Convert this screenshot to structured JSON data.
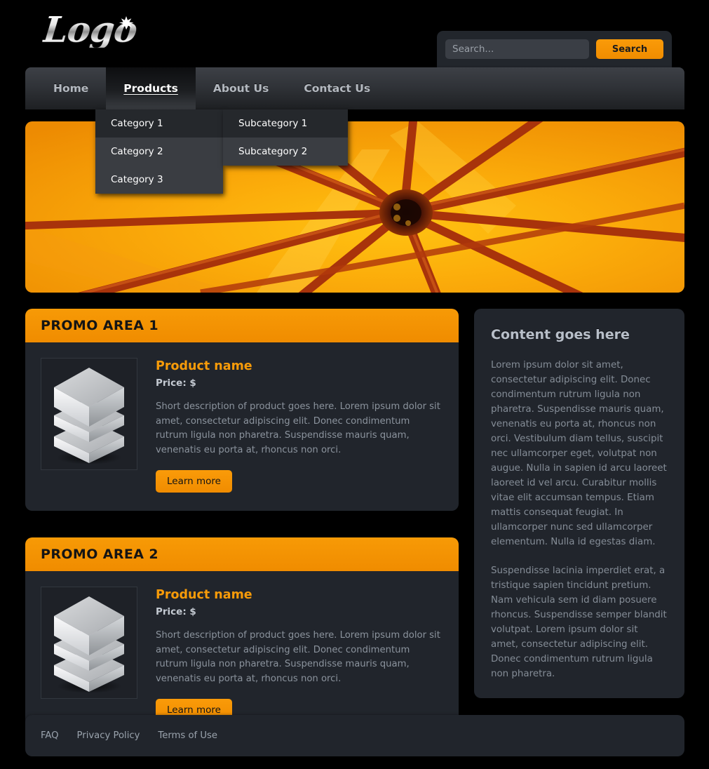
{
  "brand": {
    "logo_text": "Logo",
    "star_icon": "star-sparkle-icon"
  },
  "search": {
    "placeholder": "Search...",
    "value": "",
    "button_label": "Search"
  },
  "nav": {
    "items": [
      {
        "label": "Home",
        "active": false
      },
      {
        "label": "Products",
        "active": true
      },
      {
        "label": "About Us",
        "active": false
      },
      {
        "label": "Contact Us",
        "active": false
      }
    ]
  },
  "dropdown": {
    "categories": [
      {
        "label": "Category 1",
        "hovered": true
      },
      {
        "label": "Category 2",
        "hovered": false
      },
      {
        "label": "Category 3",
        "hovered": false
      }
    ],
    "subcategories": [
      {
        "label": "Subcategory 1"
      },
      {
        "label": "Subcategory 2"
      }
    ]
  },
  "hero": {
    "alt": "orange umbrella canopy seen from below"
  },
  "promos": [
    {
      "heading": "PROMO AREA 1",
      "product_name": "Product name",
      "price": "Price: $",
      "description": "Short description of product goes here. Lorem ipsum dolor sit amet, consectetur adipiscing elit. Donec condimentum rutrum ligula non pharetra. Suspendisse mauris quam, venenatis eu porta at, rhoncus non orci.",
      "button_label": "Learn more",
      "thumb_icon": "stacked-cubes-icon"
    },
    {
      "heading": "PROMO AREA 2",
      "product_name": "Product name",
      "price": "Price: $",
      "description": "Short description of product goes here. Lorem ipsum dolor sit amet, consectetur adipiscing elit. Donec condimentum rutrum ligula non pharetra. Suspendisse mauris quam, venenatis eu porta at, rhoncus non orci.",
      "button_label": "Learn more",
      "thumb_icon": "stacked-cubes-icon"
    }
  ],
  "sidebar": {
    "title": "Content goes here",
    "paragraphs": [
      "Lorem ipsum dolor sit amet, consectetur adipiscing elit. Donec condimentum rutrum ligula non pharetra. Suspendisse mauris quam, venenatis eu porta at, rhoncus non orci. Vestibulum diam tellus, suscipit nec ullamcorper eget, volutpat non augue. Nulla in sapien id arcu laoreet laoreet id vel arcu. Curabitur mollis vitae elit accumsan tempus. Etiam mattis consequat feugiat. In ullamcorper nunc sed ullamcorper elementum. Nulla id egestas diam.",
      "Suspendisse lacinia imperdiet erat, a tristique sapien tincidunt pretium. Nam vehicula sem id diam posuere rhoncus. Suspendisse semper blandit volutpat. Lorem ipsum dolor sit amet, consectetur adipiscing elit. Donec condimentum rutrum ligula non pharetra."
    ]
  },
  "footer": {
    "links": [
      {
        "label": "FAQ"
      },
      {
        "label": "Privacy Policy"
      },
      {
        "label": "Terms of Use"
      }
    ]
  },
  "colors": {
    "page_background": "#000000",
    "accent_orange": "#f08c00",
    "panel": "#21252c",
    "nav_top": "#3d4046",
    "nav_bottom": "#1e2023",
    "menu": "#3a3d42",
    "menu_hover": "#25282c",
    "text_muted": "#8b939d",
    "heading_light": "#b8bfc9"
  }
}
